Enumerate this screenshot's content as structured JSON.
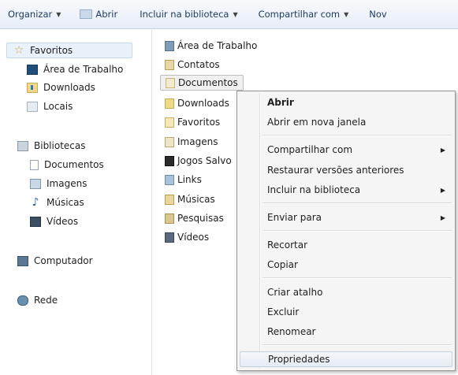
{
  "toolbar": {
    "organize": "Organizar",
    "open": "Abrir",
    "include_library": "Incluir na biblioteca",
    "share_with": "Compartilhar com",
    "new_folder": "Nov"
  },
  "nav": {
    "favorites": {
      "label": "Favoritos",
      "items": [
        "Área de Trabalho",
        "Downloads",
        "Locais"
      ]
    },
    "libraries": {
      "label": "Bibliotecas",
      "items": [
        "Documentos",
        "Imagens",
        "Músicas",
        "Vídeos"
      ]
    },
    "computer": "Computador",
    "network": "Rede"
  },
  "files": [
    "Área de Trabalho",
    "Contatos",
    "Documentos",
    "Downloads",
    "Favoritos",
    "Imagens",
    "Jogos Salvo",
    "Links",
    "Músicas",
    "Pesquisas",
    "Vídeos"
  ],
  "context_menu": {
    "open": "Abrir",
    "open_new_window": "Abrir em nova janela",
    "share_with": "Compartilhar com",
    "restore_versions": "Restaurar versões anteriores",
    "include_library": "Incluir na biblioteca",
    "send_to": "Enviar para",
    "cut": "Recortar",
    "copy": "Copiar",
    "create_shortcut": "Criar atalho",
    "delete": "Excluir",
    "rename": "Renomear",
    "properties": "Propriedades"
  },
  "icons": {
    "dropdown": "chevron-down-icon",
    "submenu": "chevron-right-icon"
  }
}
